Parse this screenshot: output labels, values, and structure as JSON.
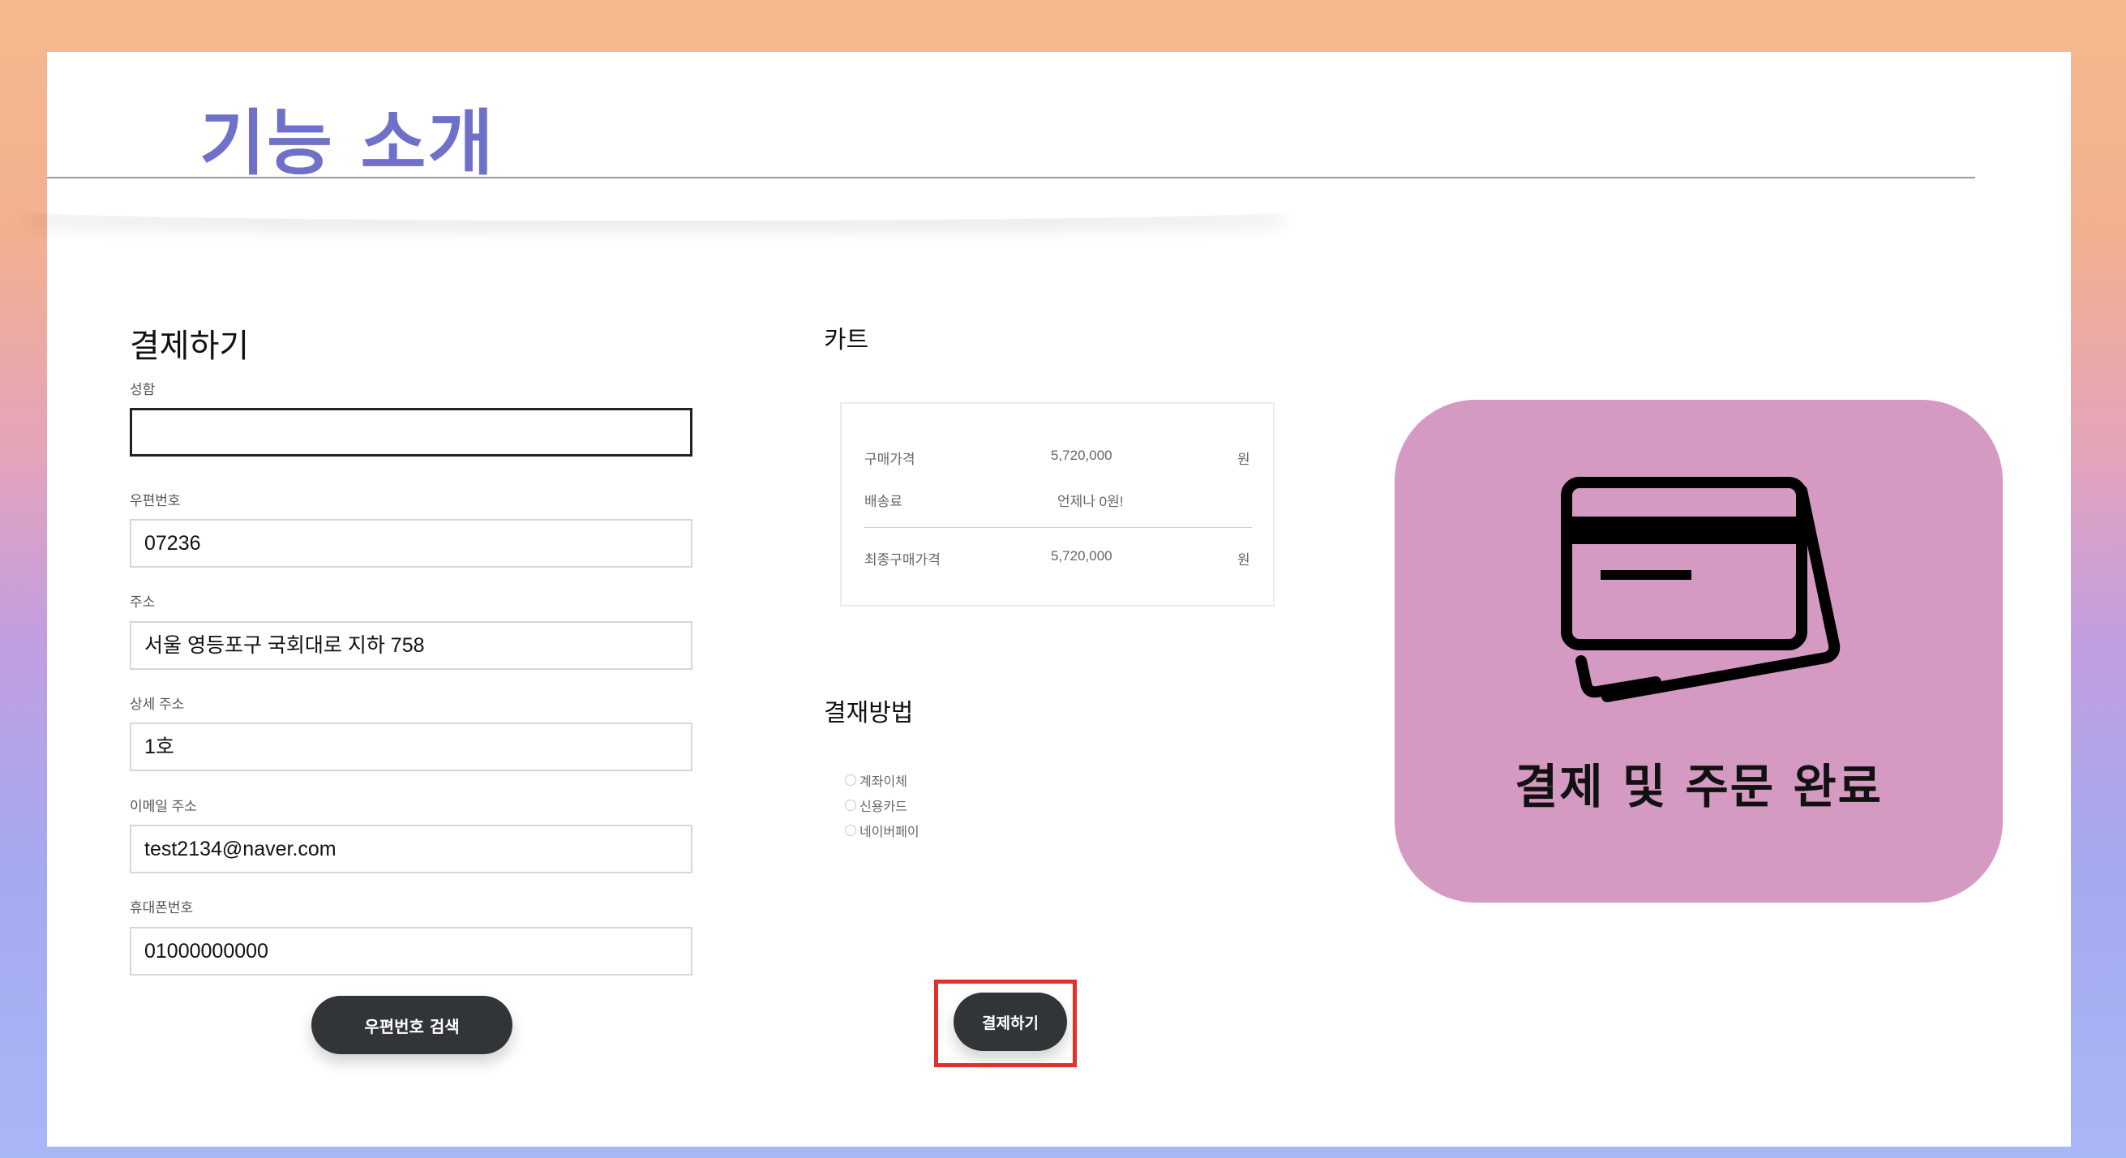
{
  "slide": {
    "title": "기능 소개"
  },
  "form": {
    "heading": "결제하기",
    "fields": [
      {
        "label": "성함",
        "value": ""
      },
      {
        "label": "우편번호",
        "value": "07236"
      },
      {
        "label": "주소",
        "value": "서울 영등포구 국회대로 지하 758"
      },
      {
        "label": "상세 주소",
        "value": "1호"
      },
      {
        "label": "이메일 주소",
        "value": "test2134@naver.com"
      },
      {
        "label": "휴대폰번호",
        "value": "01000000000"
      }
    ],
    "zip_search_button": "우편번호 검색"
  },
  "cart": {
    "heading": "카트",
    "rows": [
      {
        "label": "구매가격",
        "value": "5,720,000",
        "unit": "원"
      },
      {
        "label": "배송료",
        "value": "언제나 0원!",
        "unit": ""
      },
      {
        "label": "최종구매가격",
        "value": "5,720,000",
        "unit": "원"
      }
    ]
  },
  "payment": {
    "heading": "결재방법",
    "options": [
      "계좌이체",
      "신용카드",
      "네이버페이"
    ],
    "pay_button": "결제하기",
    "highlight_color": "#e23227"
  },
  "feature": {
    "icon": "credit-card-icon",
    "caption": "결제 및 주문 완료",
    "color": "#d59ac2"
  }
}
